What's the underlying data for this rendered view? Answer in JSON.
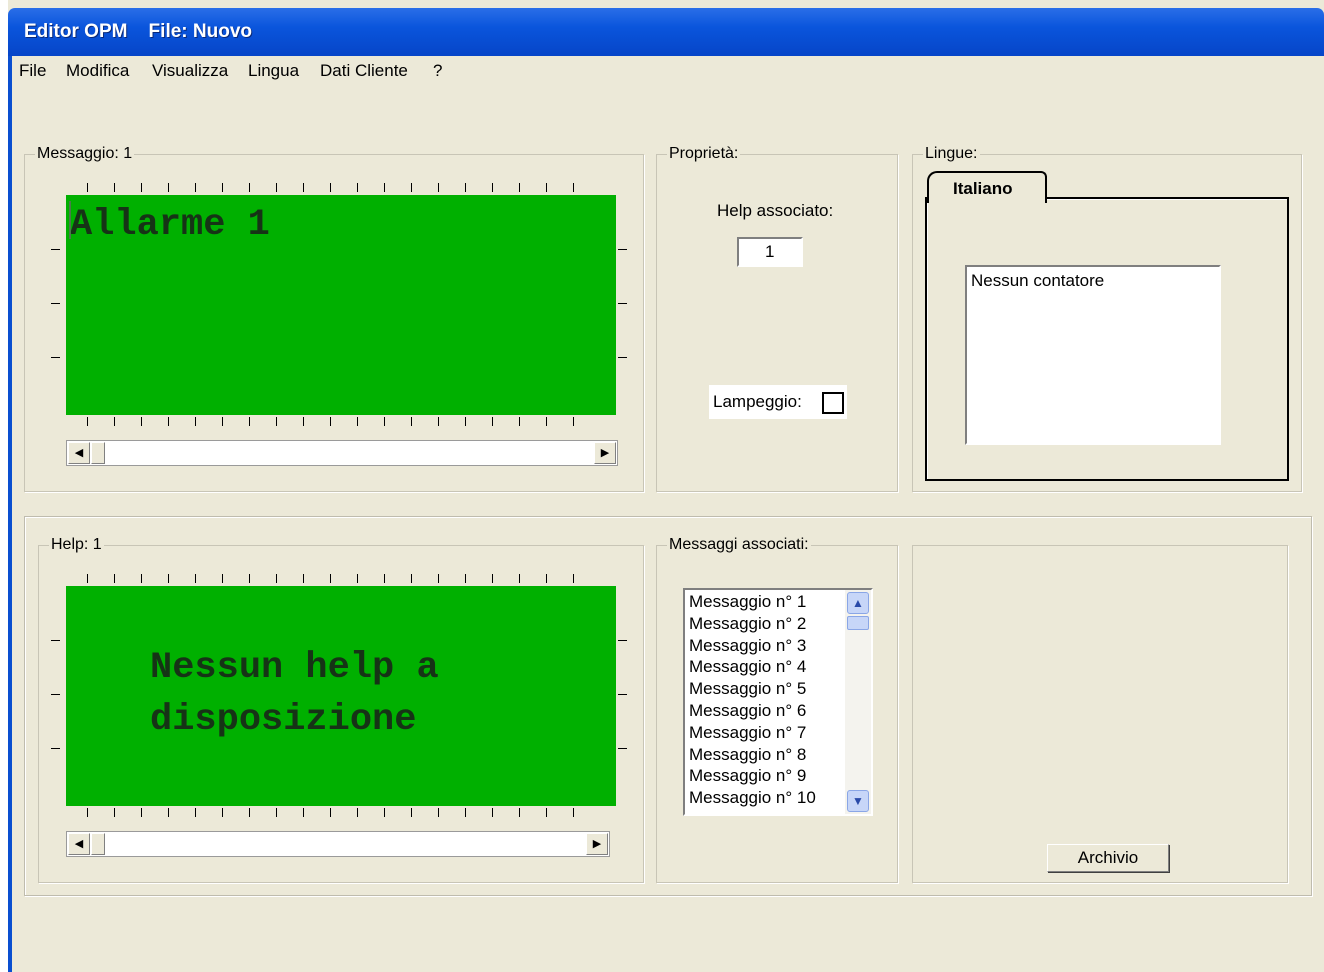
{
  "window": {
    "title": "Editor OPM    File: Nuovo"
  },
  "menu": [
    "File",
    "Modifica",
    "Visualizza",
    "Lingua",
    "Dati Cliente",
    "?"
  ],
  "messaggio": {
    "legend": "Messaggio: 1",
    "lcd_text": "Allarme 1",
    "scroll_left": "◀",
    "scroll_right": "▶"
  },
  "proprieta": {
    "legend": "Proprietà:",
    "help_label": "Help associato:",
    "help_value": "1",
    "lampeggio_label": "Lampeggio:"
  },
  "lingue": {
    "legend": "Lingue:",
    "tab_label": "Italiano",
    "counter_text": "Nessun contatore"
  },
  "help": {
    "legend": "Help: 1",
    "lcd_line1": "Nessun help a",
    "lcd_line2": "disposizione",
    "scroll_left": "◀",
    "scroll_right": "▶"
  },
  "messaggi_associati": {
    "legend": "Messaggi associati:",
    "items": [
      "Messaggio n° 1",
      "Messaggio n° 2",
      "Messaggio n° 3",
      "Messaggio n° 4",
      "Messaggio n° 5",
      "Messaggio n° 6",
      "Messaggio n° 7",
      "Messaggio n° 8",
      "Messaggio n° 9",
      "Messaggio n° 10"
    ],
    "scroll_up": "▲",
    "scroll_down": "▼"
  },
  "archivio_button": "Archivio"
}
